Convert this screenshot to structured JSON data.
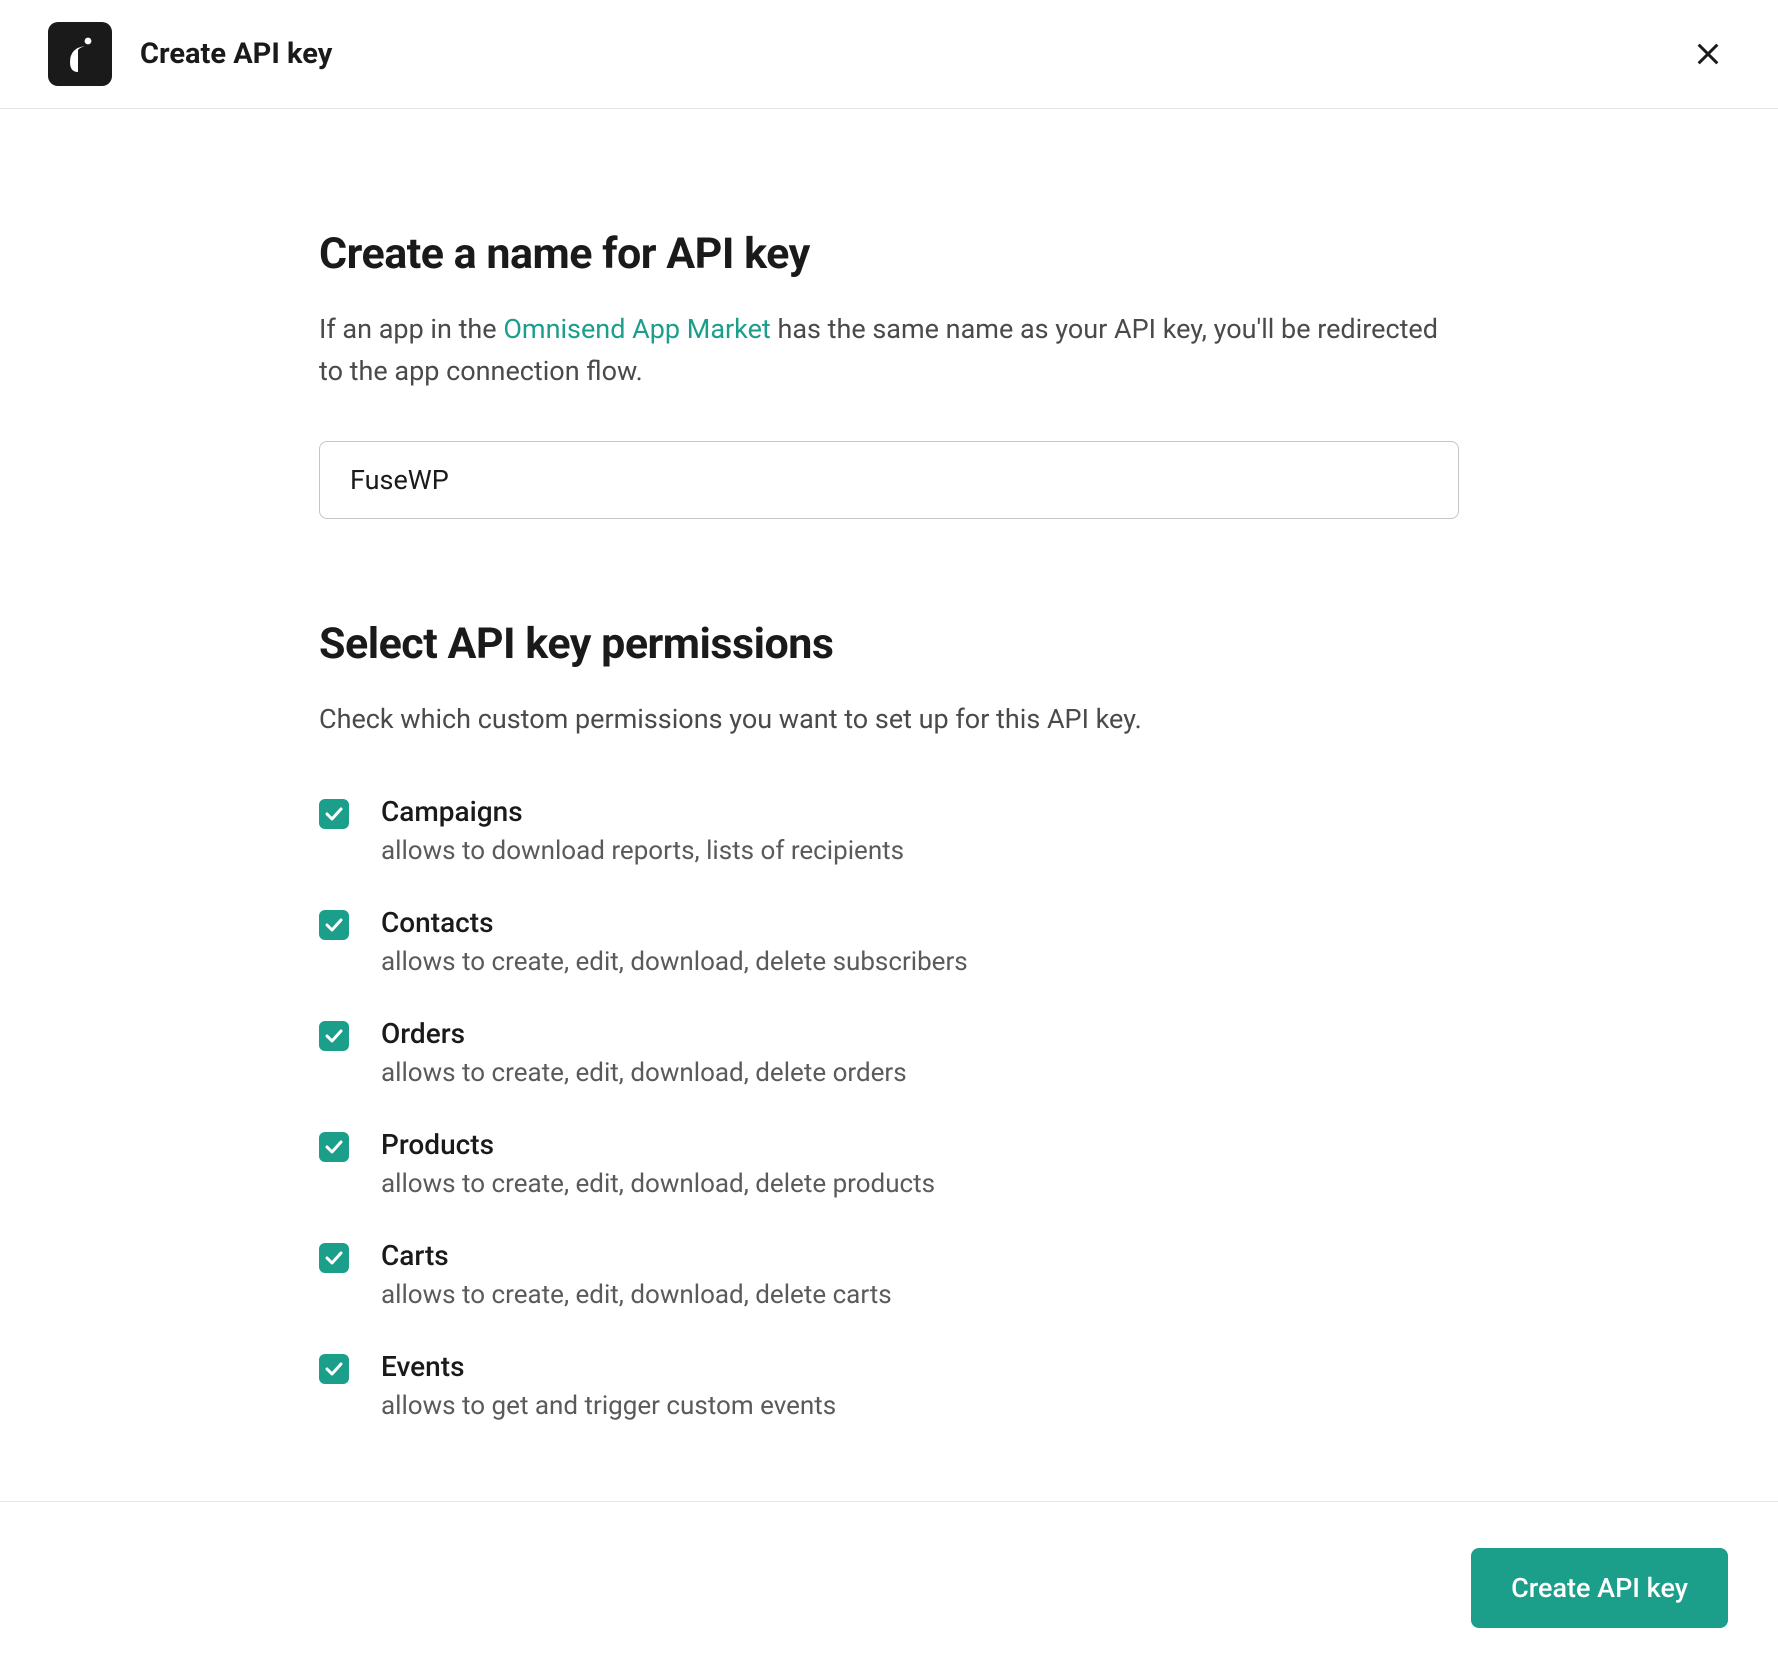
{
  "header": {
    "title": "Create API key"
  },
  "section1": {
    "title": "Create a name for API key",
    "desc_before": "If an app in the ",
    "link_text": "Omnisend App Market",
    "desc_after": " has the same name as your API key, you'll be redirected to the app connection flow.",
    "input_value": "FuseWP"
  },
  "section2": {
    "title": "Select API key permissions",
    "desc": "Check which custom permissions you want to set up for this API key."
  },
  "permissions": [
    {
      "title": "Campaigns",
      "desc": "allows to download reports, lists of recipients",
      "checked": true
    },
    {
      "title": "Contacts",
      "desc": "allows to create, edit, download, delete subscribers",
      "checked": true
    },
    {
      "title": "Orders",
      "desc": "allows to create, edit, download, delete orders",
      "checked": true
    },
    {
      "title": "Products",
      "desc": "allows to create, edit, download, delete products",
      "checked": true
    },
    {
      "title": "Carts",
      "desc": "allows to create, edit, download, delete carts",
      "checked": true
    },
    {
      "title": "Events",
      "desc": "allows to get and trigger custom events",
      "checked": true
    }
  ],
  "footer": {
    "create_label": "Create API key"
  }
}
